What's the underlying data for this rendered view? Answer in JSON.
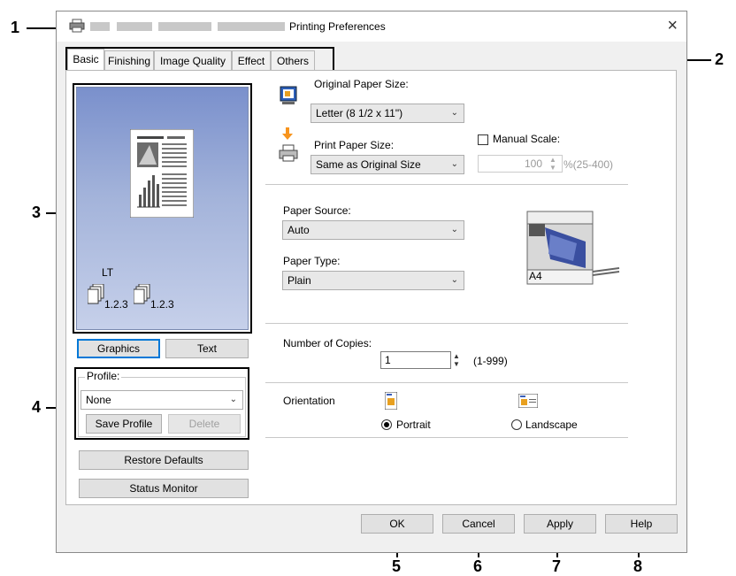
{
  "window": {
    "title": "Printing Preferences",
    "close_glyph": "×"
  },
  "tabs": [
    {
      "label": "Basic",
      "active": true
    },
    {
      "label": "Finishing",
      "active": false
    },
    {
      "label": "Image Quality",
      "active": false
    },
    {
      "label": "Effect",
      "active": false
    },
    {
      "label": "Others",
      "active": false
    }
  ],
  "preview": {
    "paper_label": "LT",
    "copies_label_1": "1.2.3",
    "copies_label_2": "1.2.3",
    "graphics_button": "Graphics",
    "text_button": "Text"
  },
  "profile": {
    "group_label": "Profile:",
    "selected": "None",
    "save_button": "Save Profile",
    "delete_button": "Delete"
  },
  "restore_defaults_button": "Restore Defaults",
  "status_monitor_button": "Status Monitor",
  "paper": {
    "original_size_label": "Original Paper Size:",
    "original_size_value": "Letter (8 1/2 x 11\")",
    "print_size_label": "Print Paper Size:",
    "print_size_value": "Same as Original Size",
    "manual_scale_label": "Manual Scale:",
    "manual_scale_value": "100",
    "manual_scale_range": "%(25-400)",
    "source_label": "Paper Source:",
    "source_value": "Auto",
    "type_label": "Paper Type:",
    "type_value": "Plain",
    "tray_label": "A4"
  },
  "copies": {
    "label": "Number of Copies:",
    "value": "1",
    "range": "(1-999)"
  },
  "orientation": {
    "label": "Orientation",
    "portrait": "Portrait",
    "landscape": "Landscape",
    "selected": "Portrait"
  },
  "footer": {
    "ok": "OK",
    "cancel": "Cancel",
    "apply": "Apply",
    "help": "Help"
  },
  "callouts": [
    "1",
    "2",
    "3",
    "4",
    "5",
    "6",
    "7",
    "8"
  ],
  "colors": {
    "focus_accent": "#0078d7",
    "arrow_orange": "#f7941d",
    "preview_top": "#7a90cc",
    "preview_bottom": "#c6d0ea"
  }
}
